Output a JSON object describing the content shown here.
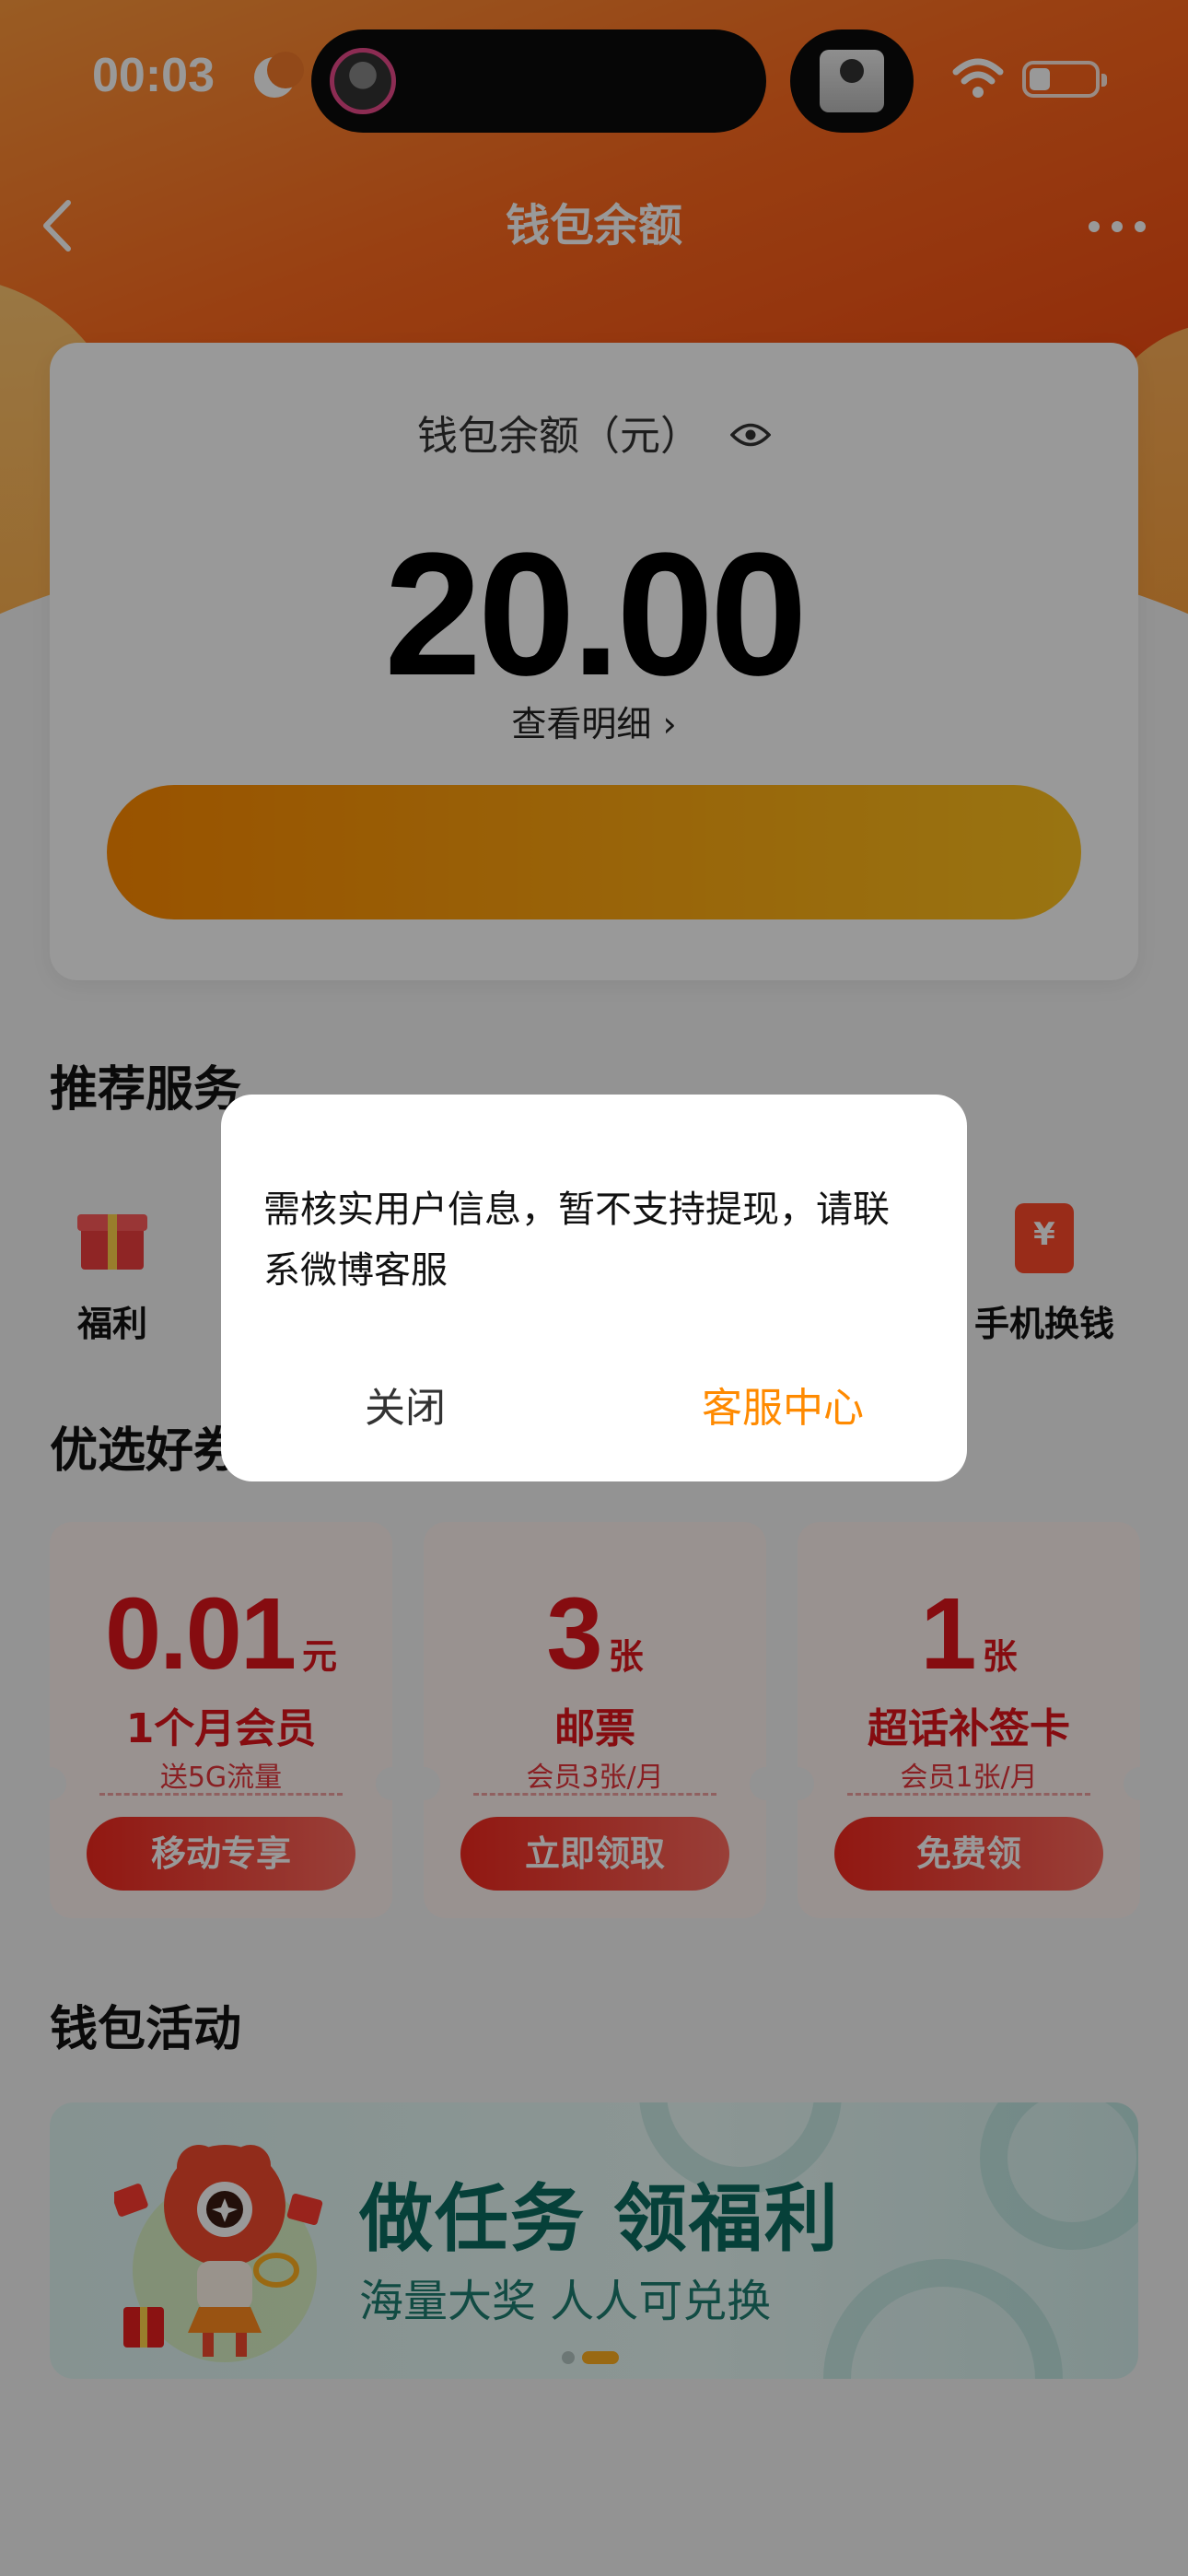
{
  "status_bar": {
    "time": "00:03"
  },
  "nav": {
    "title": "钱包余额"
  },
  "balance": {
    "label": "钱包余额（元）",
    "amount": "20.00",
    "detail_link": "查看明细 ›"
  },
  "sections": {
    "services_title": "推荐服务",
    "picks_title": "优选好券",
    "activity_title": "钱包活动"
  },
  "services": [
    {
      "label": "福利",
      "icon": "gift-icon"
    },
    {
      "label": "手机换钱",
      "icon": "phone-exchange-icon"
    }
  ],
  "coupons": [
    {
      "value": "0.01",
      "unit": "元",
      "title": "1个月会员",
      "subtitle": "送5G流量",
      "button": "移动专享"
    },
    {
      "value": "3",
      "unit": "张",
      "title": "邮票",
      "subtitle": "会员3张/月",
      "button": "立即领取"
    },
    {
      "value": "1",
      "unit": "张",
      "title": "超话补签卡",
      "subtitle": "会员1张/月",
      "button": "免费领"
    }
  ],
  "activity_banner": {
    "title": "做任务 领福利",
    "subtitle": "海量大奖 人人可兑换",
    "active_slide": 2,
    "slide_count": 2
  },
  "dialog": {
    "message": "需核实用户信息，暂不支持提现，请联系微博客服",
    "close_label": "关闭",
    "service_label": "客服中心"
  },
  "colors": {
    "accent": "#ff8a00",
    "coupon_red": "#e0151c",
    "header_orange": "#f24a12",
    "banner_teal": "#0b6c60"
  }
}
